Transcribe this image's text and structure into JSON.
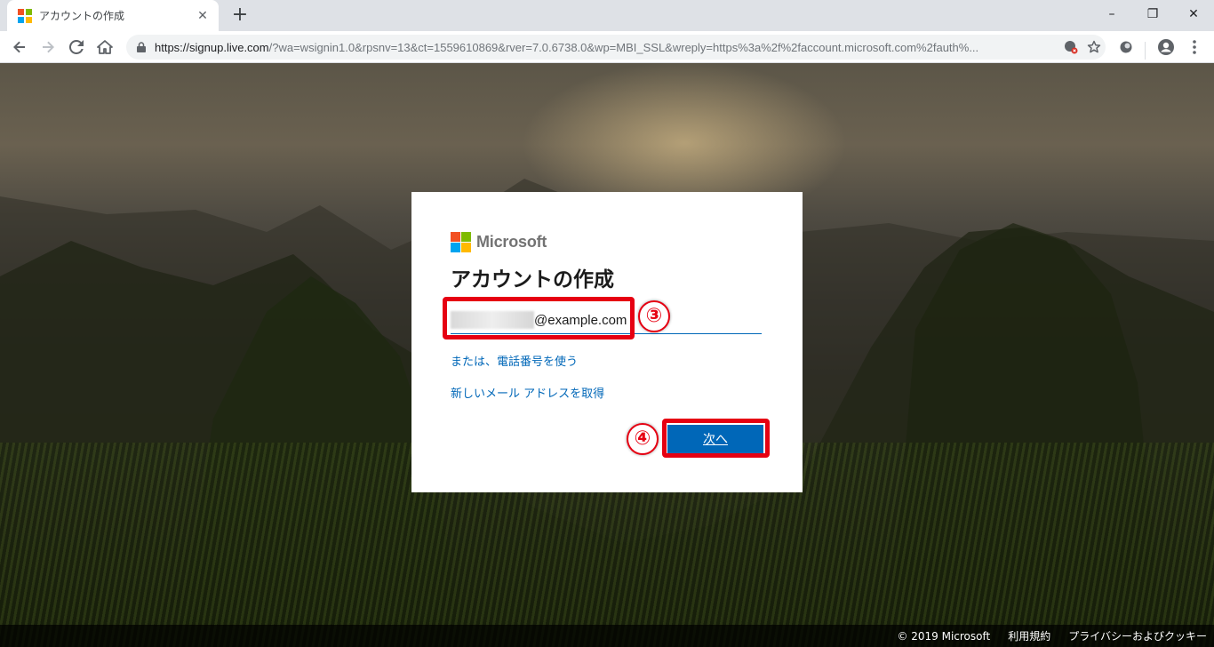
{
  "browser": {
    "tab_title": "アカウントの作成",
    "tab_close": "✕",
    "new_tab": "+",
    "url_host": "https://signup.live.com",
    "url_rest": "/?wa=wsignin1.0&rpsnv=13&ct=1559610869&rver=7.0.6738.0&wp=MBI_SSL&wreply=https%3a%2f%2faccount.microsoft.com%2fauth%...",
    "minimize": "–",
    "maximize": "❐",
    "close": "✕"
  },
  "card": {
    "brand": "Microsoft",
    "title": "アカウントの作成",
    "email_value": "@example.com",
    "link_phone": "または、電話番号を使う",
    "link_new_email": "新しいメール アドレスを取得",
    "next_label": "次へ"
  },
  "annotations": {
    "step_3": "③",
    "step_4": "④"
  },
  "footer": {
    "copyright": "© 2019 Microsoft",
    "terms": "利用規約",
    "privacy": "プライバシーおよびクッキー"
  },
  "colors": {
    "ms_red": "#f25022",
    "ms_green": "#7fba00",
    "ms_blue": "#00a4ef",
    "ms_yellow": "#ffb900",
    "accent": "#0067b8",
    "highlight": "#e60012"
  }
}
